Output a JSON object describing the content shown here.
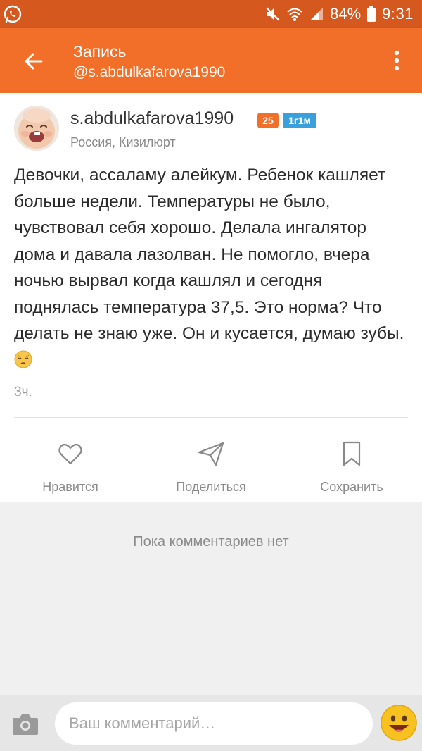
{
  "status_bar": {
    "battery": "84%",
    "time": "9:31",
    "icons": [
      "whatsapp-icon",
      "mute-icon",
      "wifi-icon",
      "signal-icon",
      "battery-icon"
    ]
  },
  "app_bar": {
    "title": "Запись",
    "subtitle": "@s.abdulkafarova1990",
    "background": "#f26f2a"
  },
  "post": {
    "author": "s.abdulkafarova1990",
    "badge_age": "25",
    "badge_duration": "1г1м",
    "location": "Россия, Кизилюрт",
    "text": "Девочки, ассаламу алейкум. Ребенок кашляет больше недели. Температуры не было, чувствовал себя хорошо.  Делала ингалятор дома и давала лазолван. Не помогло, вчера ночью вырвал когда кашлял и сегодня поднялась температура 37,5. Это норма? Что делать не знаю уже. Он и кусается, думаю зубы.",
    "time": "3ч."
  },
  "actions": {
    "like": "Нравится",
    "share": "Поделиться",
    "save": "Сохранить"
  },
  "comments": {
    "empty_text": "Пока комментариев нет"
  },
  "comment_bar": {
    "placeholder": "Ваш комментарий…"
  }
}
